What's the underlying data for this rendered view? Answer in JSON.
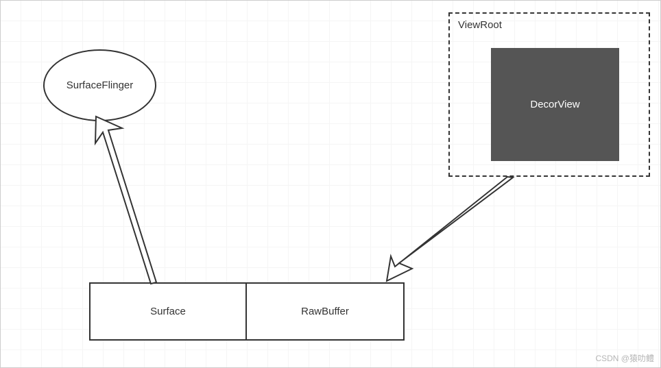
{
  "ellipse": {
    "label": "SurfaceFlinger"
  },
  "dashedBox": {
    "label": "ViewRoot",
    "inner": {
      "label": "DecorView"
    }
  },
  "rowBoxes": {
    "left": "Surface",
    "right": "RawBuffer"
  },
  "watermark": "CSDN @猿叻鳢"
}
